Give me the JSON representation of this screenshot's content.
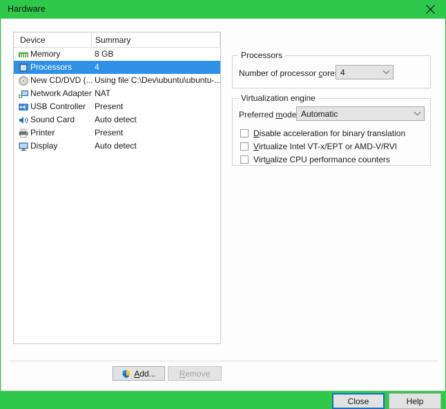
{
  "window": {
    "title": "Hardware",
    "close_icon": "close-icon",
    "titlebar_color": "#2ec94a",
    "accent_color": "#2f90e8"
  },
  "device_list": {
    "columns": [
      "Device",
      "Summary"
    ],
    "selected_index": 1,
    "rows": [
      {
        "icon": "memory-icon",
        "device": "Memory",
        "summary": "8 GB"
      },
      {
        "icon": "processor-icon",
        "device": "Processors",
        "summary": "4"
      },
      {
        "icon": "cd-dvd-icon",
        "device": "New CD/DVD (...",
        "summary": "Using file C:\\Dev\\ubuntu\\ubuntu-..."
      },
      {
        "icon": "network-adapter-icon",
        "device": "Network Adapter",
        "summary": "NAT"
      },
      {
        "icon": "usb-controller-icon",
        "device": "USB Controller",
        "summary": "Present"
      },
      {
        "icon": "sound-card-icon",
        "device": "Sound Card",
        "summary": "Auto detect"
      },
      {
        "icon": "printer-icon",
        "device": "Printer",
        "summary": "Present"
      },
      {
        "icon": "display-icon",
        "device": "Display",
        "summary": "Auto detect"
      }
    ],
    "add_button": {
      "label": "Add...",
      "accel": "A",
      "icon": "uac-shield-icon"
    },
    "remove_button": {
      "label": "Remove",
      "accel": "R",
      "disabled": true
    }
  },
  "processors_group": {
    "legend": "Processors",
    "cores_label_pre": "Number of processor ",
    "cores_label_accel": "c",
    "cores_label_post": "ores:",
    "cores_value": "4"
  },
  "virtualization_group": {
    "legend": "Virtualization engine",
    "mode_label_pre": "Preferred ",
    "mode_label_accel": "m",
    "mode_label_post": "ode:",
    "mode_value": "Automatic",
    "checkboxes": [
      {
        "pre": "",
        "accel": "D",
        "post": "isable acceleration for binary translation",
        "checked": false
      },
      {
        "pre": "",
        "accel": "V",
        "post": "irtualize Intel VT-x/EPT or AMD-V/RVI",
        "checked": false
      },
      {
        "pre": "Virt",
        "accel": "u",
        "post": "alize CPU performance counters",
        "checked": false
      }
    ]
  },
  "footer": {
    "close_label": "Close",
    "help_label": "Help"
  }
}
